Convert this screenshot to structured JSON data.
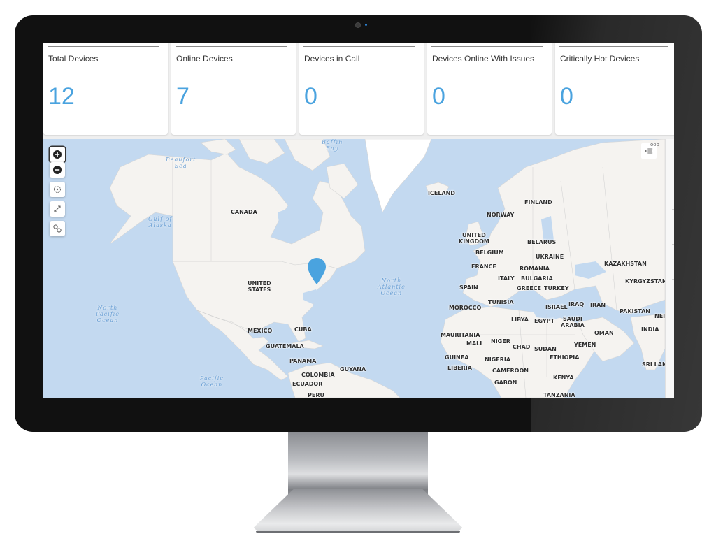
{
  "dashboard": {
    "cards": [
      {
        "title": "Total Devices",
        "value": "12"
      },
      {
        "title": "Online Devices",
        "value": "7"
      },
      {
        "title": "Devices in Call",
        "value": "0"
      },
      {
        "title": "Devices Online With Issues",
        "value": "0"
      },
      {
        "title": "Critically Hot Devices",
        "value": "0"
      }
    ],
    "accent_color": "#4aa3df"
  },
  "map": {
    "controls": [
      {
        "name": "zoom-in",
        "icon": "plus-circle-icon"
      },
      {
        "name": "zoom-out",
        "icon": "minus-circle-icon"
      },
      {
        "name": "locate",
        "icon": "crosshair-icon"
      },
      {
        "name": "fullscreen",
        "icon": "expand-icon"
      },
      {
        "name": "map-style",
        "icon": "wrench-icon"
      }
    ],
    "legend_button_icon": "legend-list-icon",
    "more_icon": "ooo",
    "pin": {
      "color": "#4aa3df",
      "location": "Northeastern United States"
    },
    "country_labels": {
      "canada": "CANADA",
      "united_states": "UNITED\nSTATES",
      "mexico": "MEXICO",
      "cuba": "CUBA",
      "guatemala": "GUATEMALA",
      "panama": "PANAMA",
      "colombia": "COLOMBIA",
      "guyana": "GUYANA",
      "ecuador": "ECUADOR",
      "peru": "PERU",
      "iceland": "ICELAND",
      "norway": "NORWAY",
      "finland": "FINLAND",
      "united_kingdom": "UNITED\nKINGDOM",
      "belgium": "BELGIUM",
      "belarus": "BELARUS",
      "ukraine": "UKRAINE",
      "france": "FRANCE",
      "romania": "ROMANIA",
      "italy": "ITALY",
      "bulgaria": "BULGARIA",
      "spain": "SPAIN",
      "greece": "GREECE",
      "turkey": "TURKEY",
      "kazakhstan": "KAZAKHSTAN",
      "kyrgyzstan": "KYRGYZSTAN",
      "tunisia": "TUNISIA",
      "morocco": "MOROCCO",
      "israel": "ISRAEL",
      "iraq": "IRAQ",
      "iran": "IRAN",
      "pakistan": "PAKISTAN",
      "nepal": "NEI",
      "libya": "LIBYA",
      "egypt": "EGYPT",
      "saudi_arabia": "SAUDI\nARABIA",
      "india": "INDIA",
      "oman": "OMAN",
      "mauritania": "MAURITANIA",
      "mali": "MALI",
      "niger": "NIGER",
      "chad": "CHAD",
      "sudan": "SUDAN",
      "yemen": "YEMEN",
      "guinea": "GUINEA",
      "nigeria": "NIGERIA",
      "ethiopia": "ETHIOPIA",
      "liberia": "LIBERIA",
      "cameroon": "CAMEROON",
      "sri_lanka": "SRI LAN",
      "gabon": "GABON",
      "kenya": "KENYA",
      "tanzania": "TANZANIA"
    },
    "water_labels": {
      "beaufort": "Beaufort\nSea",
      "baffin": "Baffin\nBay",
      "gulf_alaska": "Gulf of\nAlaska",
      "north_atlantic": "North\nAtlantic\nOcean",
      "north_pacific": "North\nPacific\nOcean",
      "pacific": "Pacific\nOcean"
    }
  }
}
